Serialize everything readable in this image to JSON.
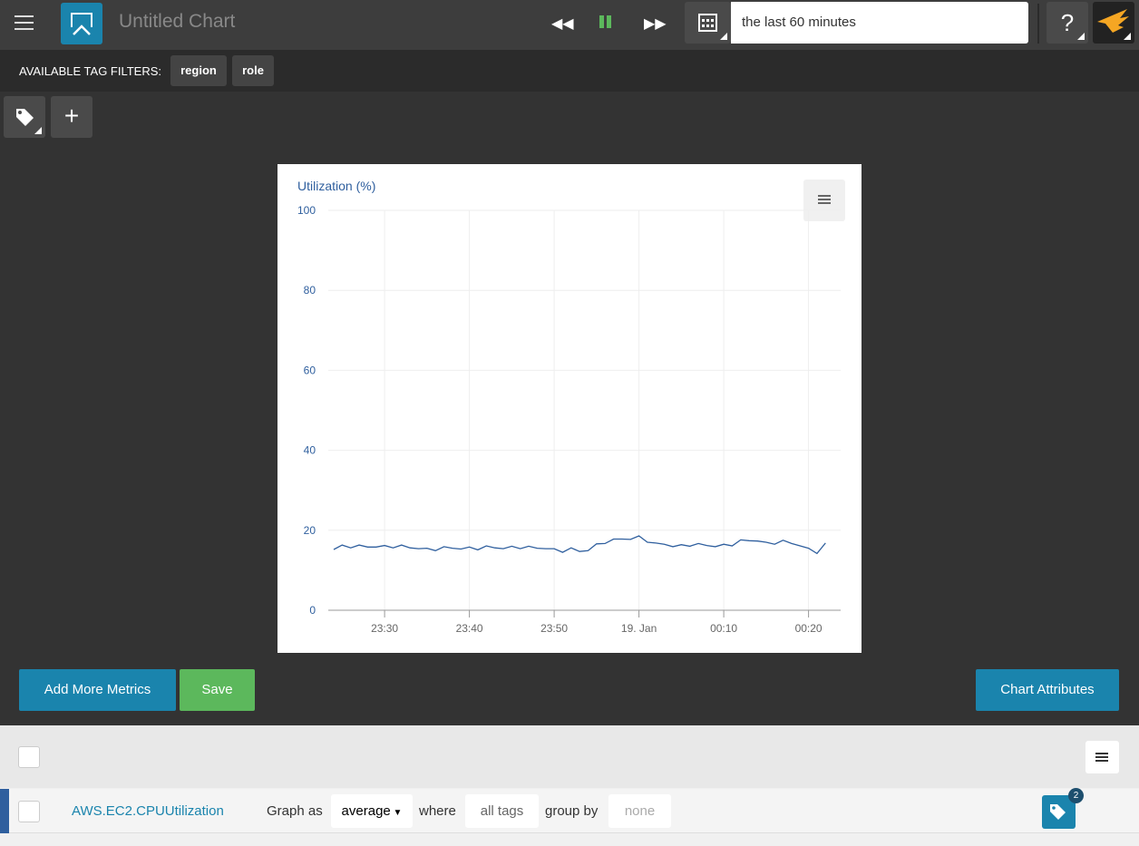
{
  "header": {
    "title": "Untitled Chart",
    "time_range": "the last 60 minutes",
    "help_label": "?"
  },
  "tag_filters": {
    "label": "AVAILABLE TAG FILTERS:",
    "items": [
      "region",
      "role"
    ]
  },
  "colors": {
    "accent": "#1a84ad",
    "save": "#5cb85c",
    "line": "#2f5f9e",
    "pause": "#5cb85c"
  },
  "chart_data": {
    "type": "line",
    "title": "Utilization (%)",
    "ylim": [
      0,
      100
    ],
    "yticks": [
      "0",
      "20",
      "40",
      "60",
      "80",
      "100"
    ],
    "xticks": [
      "23:30",
      "23:40",
      "23:50",
      "19. Jan",
      "00:10",
      "00:20"
    ],
    "grid": true,
    "x": [
      "23:24",
      "23:25",
      "23:26",
      "23:27",
      "23:28",
      "23:29",
      "23:30",
      "23:31",
      "23:32",
      "23:33",
      "23:34",
      "23:35",
      "23:36",
      "23:37",
      "23:38",
      "23:39",
      "23:40",
      "23:41",
      "23:42",
      "23:43",
      "23:44",
      "23:45",
      "23:46",
      "23:47",
      "23:48",
      "23:49",
      "23:50",
      "23:51",
      "23:52",
      "23:53",
      "23:54",
      "23:55",
      "23:56",
      "23:57",
      "23:58",
      "23:59",
      "00:00",
      "00:01",
      "00:02",
      "00:03",
      "00:04",
      "00:05",
      "00:06",
      "00:07",
      "00:08",
      "00:09",
      "00:10",
      "00:11",
      "00:12",
      "00:13",
      "00:14",
      "00:15",
      "00:16",
      "00:17",
      "00:18",
      "00:19",
      "00:20",
      "00:21",
      "00:22"
    ],
    "values": [
      15.2,
      16.3,
      15.6,
      16.3,
      15.8,
      15.8,
      16.2,
      15.6,
      16.3,
      15.6,
      15.4,
      15.5,
      14.9,
      15.9,
      15.5,
      15.3,
      15.8,
      15.1,
      16.1,
      15.6,
      15.4,
      16.0,
      15.4,
      16.0,
      15.5,
      15.4,
      15.4,
      14.5,
      15.6,
      14.7,
      14.9,
      16.6,
      16.7,
      17.8,
      17.8,
      17.7,
      18.6,
      17.0,
      16.8,
      16.5,
      15.9,
      16.4,
      16.0,
      16.7,
      16.2,
      15.9,
      16.5,
      16.1,
      17.6,
      17.4,
      17.3,
      17.0,
      16.5,
      17.5,
      16.7,
      16.1,
      15.5,
      14.2,
      16.8
    ]
  },
  "actions": {
    "add_metrics": "Add More Metrics",
    "save": "Save",
    "attributes": "Chart Attributes"
  },
  "metric": {
    "name": "AWS.EC2.CPUUtilization",
    "graph_as_label": "Graph as",
    "aggregation": "average",
    "where_label": "where",
    "where_value": "all tags",
    "group_by_label": "group by",
    "group_by_value": "none",
    "tag_count": "2"
  }
}
